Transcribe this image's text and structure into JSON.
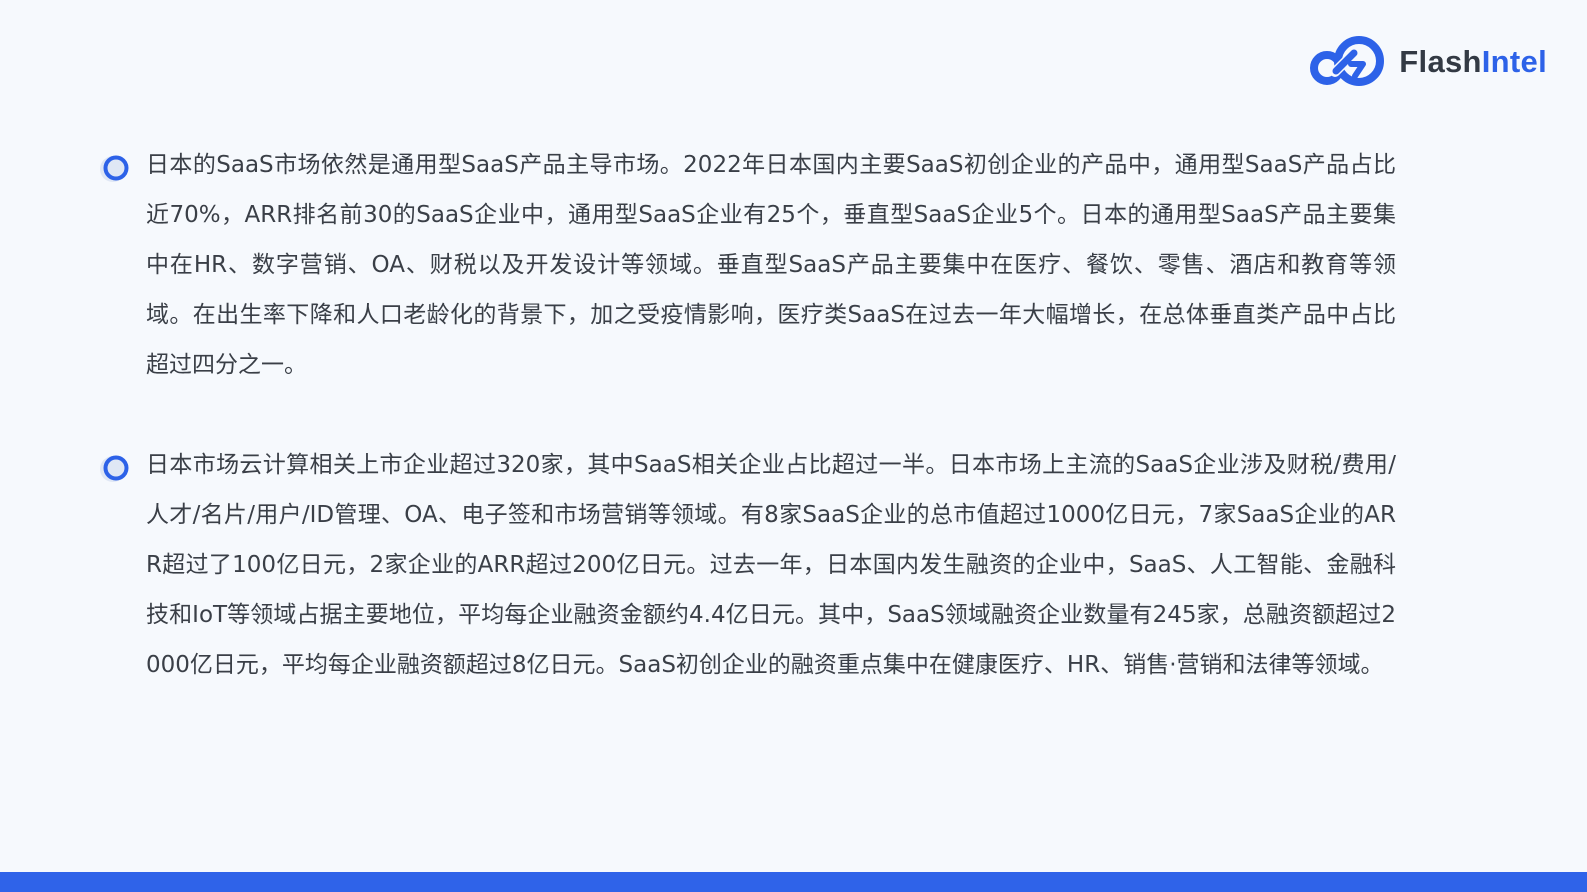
{
  "brand": {
    "name_part1": "Flash",
    "name_part2": "Intel",
    "logo_icon": "infinity-loop-icon",
    "primary_color": "#2d62e8",
    "text_color": "#333a44"
  },
  "paragraphs": [
    {
      "bullet_icon": "ring-bullet-icon",
      "text": "日本的SaaS市场依然是通用型SaaS产品主导市场。2022年日本国内主要SaaS初创企业的产品中，通用型SaaS产品占比近70%，ARR排名前30的SaaS企业中，通用型SaaS企业有25个，垂直型SaaS企业5个。日本的通用型SaaS产品主要集中在HR、数字营销、OA、财税以及开发设计等领域。垂直型SaaS产品主要集中在医疗、餐饮、零售、酒店和教育等领域。在出生率下降和人口老龄化的背景下，加之受疫情影响，医疗类SaaS在过去一年大幅增长，在总体垂直类产品中占比超过四分之一。"
    },
    {
      "bullet_icon": "ring-bullet-icon",
      "text": "日本市场云计算相关上市企业超过320家，其中SaaS相关企业占比超过一半。日本市场上主流的SaaS企业涉及财税/费用/人才/名片/用户/ID管理、OA、电子签和市场营销等领域。有8家SaaS企业的总市值超过1000亿日元，7家SaaS企业的ARR超过了100亿日元，2家企业的ARR超过200亿日元。过去一年，日本国内发生融资的企业中，SaaS、人工智能、金融科技和IoT等领域占据主要地位，平均每企业融资金额约4.4亿日元。其中，SaaS领域融资企业数量有245家，总融资额超过2000亿日元，平均每企业融资额超过8亿日元。SaaS初创企业的融资重点集中在健康医疗、HR、销售·营销和法律等领域。"
    }
  ],
  "footer": {
    "bar_color": "#2f63e9"
  }
}
